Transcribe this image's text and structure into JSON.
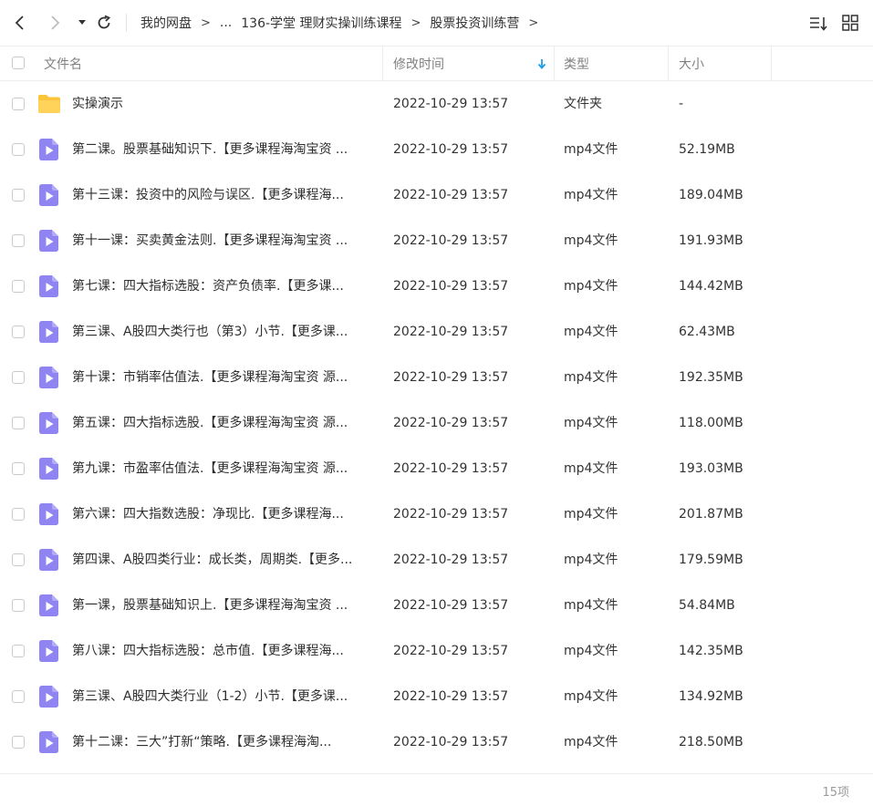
{
  "breadcrumb": {
    "root": "我的网盘",
    "ellipsis": "...",
    "level2": "136-学堂 理财实操训练课程",
    "current": "股票投资训练营",
    "sep": ">"
  },
  "columns": {
    "name": "文件名",
    "mtime": "修改时间",
    "type": "类型",
    "size": "大小"
  },
  "colors": {
    "folder": "#fbc53a",
    "video": "#8f84f2",
    "sort_arrow": "#1ea0e6"
  },
  "files": [
    {
      "icon": "folder-icon",
      "name": "实操演示",
      "mtime": "2022-10-29 13:57",
      "type": "文件夹",
      "size": "-"
    },
    {
      "icon": "video-file-icon",
      "name": "第二课。股票基础知识下.【更多课程海淘宝资 ...",
      "mtime": "2022-10-29 13:57",
      "type": "mp4文件",
      "size": "52.19MB"
    },
    {
      "icon": "video-file-icon",
      "name": "第十三课：投资中的风险与误区.【更多课程海...",
      "mtime": "2022-10-29 13:57",
      "type": "mp4文件",
      "size": "189.04MB"
    },
    {
      "icon": "video-file-icon",
      "name": "第十一课：买卖黄金法则.【更多课程海淘宝资 ...",
      "mtime": "2022-10-29 13:57",
      "type": "mp4文件",
      "size": "191.93MB"
    },
    {
      "icon": "video-file-icon",
      "name": "第七课：四大指标选股：资产负债率.【更多课...",
      "mtime": "2022-10-29 13:57",
      "type": "mp4文件",
      "size": "144.42MB"
    },
    {
      "icon": "video-file-icon",
      "name": "第三课、A股四大类行也（第3）小节.【更多课...",
      "mtime": "2022-10-29 13:57",
      "type": "mp4文件",
      "size": "62.43MB"
    },
    {
      "icon": "video-file-icon",
      "name": "第十课：市销率估值法.【更多课程海淘宝资 源...",
      "mtime": "2022-10-29 13:57",
      "type": "mp4文件",
      "size": "192.35MB"
    },
    {
      "icon": "video-file-icon",
      "name": "第五课：四大指标选股.【更多课程海淘宝资 源...",
      "mtime": "2022-10-29 13:57",
      "type": "mp4文件",
      "size": "118.00MB"
    },
    {
      "icon": "video-file-icon",
      "name": "第九课：市盈率估值法.【更多课程海淘宝资 源...",
      "mtime": "2022-10-29 13:57",
      "type": "mp4文件",
      "size": "193.03MB"
    },
    {
      "icon": "video-file-icon",
      "name": "第六课：四大指数选股：净现比.【更多课程海...",
      "mtime": "2022-10-29 13:57",
      "type": "mp4文件",
      "size": "201.87MB"
    },
    {
      "icon": "video-file-icon",
      "name": "第四课、A股四类行业：成长类，周期类.【更多...",
      "mtime": "2022-10-29 13:57",
      "type": "mp4文件",
      "size": "179.59MB"
    },
    {
      "icon": "video-file-icon",
      "name": "第一课，股票基础知识上.【更多课程海淘宝资 ...",
      "mtime": "2022-10-29 13:57",
      "type": "mp4文件",
      "size": "54.84MB"
    },
    {
      "icon": "video-file-icon",
      "name": "第八课：四大指标选股：总市值.【更多课程海...",
      "mtime": "2022-10-29 13:57",
      "type": "mp4文件",
      "size": "142.35MB"
    },
    {
      "icon": "video-file-icon",
      "name": "第三课、A股四大类行业（1-2）小节.【更多课...",
      "mtime": "2022-10-29 13:57",
      "type": "mp4文件",
      "size": "134.92MB"
    },
    {
      "icon": "video-file-icon",
      "name": "第十二课：三大”打新“策略.【更多课程海淘...",
      "mtime": "2022-10-29 13:57",
      "type": "mp4文件",
      "size": "218.50MB"
    }
  ],
  "footer": {
    "count": "15项"
  }
}
